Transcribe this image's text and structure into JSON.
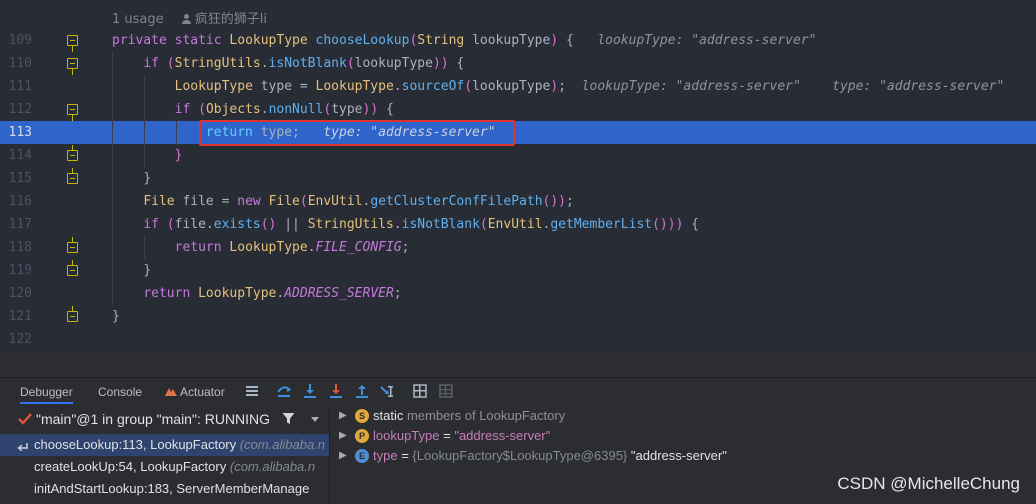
{
  "editor": {
    "usage_count": "1 usage",
    "author": "疯狂的狮子li",
    "lines": [
      {
        "num": "109",
        "tokens": [
          [
            "kw",
            "private "
          ],
          [
            "kw",
            "static "
          ],
          [
            "ty",
            "LookupType "
          ],
          [
            "fn",
            "chooseLookup"
          ],
          [
            "par",
            "("
          ],
          [
            "ty",
            "String "
          ],
          [
            "pun",
            "lookupType"
          ],
          [
            "par",
            ")"
          ],
          [
            "pun",
            " {   "
          ],
          [
            "hint",
            "lookupType: \"address-server\""
          ]
        ]
      },
      {
        "num": "110",
        "tokens": [
          [
            "pun",
            "    "
          ],
          [
            "kw",
            "if "
          ],
          [
            "par",
            "("
          ],
          [
            "ty",
            "StringUtils"
          ],
          [
            "pun",
            "."
          ],
          [
            "fn",
            "isNotBlank"
          ],
          [
            "par",
            "("
          ],
          [
            "pun",
            "lookupType"
          ],
          [
            "par",
            "))"
          ],
          [
            "pun",
            " {"
          ]
        ]
      },
      {
        "num": "111",
        "tokens": [
          [
            "pun",
            "        "
          ],
          [
            "ty",
            "LookupType "
          ],
          [
            "pun",
            "type = "
          ],
          [
            "ty",
            "LookupType"
          ],
          [
            "pun",
            "."
          ],
          [
            "fn",
            "sourceOf"
          ],
          [
            "par",
            "("
          ],
          [
            "pun",
            "lookupType"
          ],
          [
            "par",
            ")"
          ],
          [
            "pun",
            ";  "
          ],
          [
            "hint",
            "lookupType: \"address-server\"    type: \"address-server\""
          ]
        ]
      },
      {
        "num": "112",
        "tokens": [
          [
            "pun",
            "        "
          ],
          [
            "kw",
            "if "
          ],
          [
            "par",
            "("
          ],
          [
            "ty",
            "Objects"
          ],
          [
            "pun",
            "."
          ],
          [
            "fn",
            "nonNull"
          ],
          [
            "par",
            "("
          ],
          [
            "pun",
            "type"
          ],
          [
            "par",
            "))"
          ],
          [
            "pun",
            " {"
          ]
        ]
      },
      {
        "num": "113",
        "tokens": [
          [
            "pun",
            "            "
          ],
          [
            "kw",
            "return "
          ],
          [
            "pun",
            "type;   "
          ],
          [
            "hint",
            "type: \"address-server\""
          ]
        ]
      },
      {
        "num": "114",
        "tokens": [
          [
            "pun",
            "        "
          ],
          [
            "par",
            "}"
          ]
        ]
      },
      {
        "num": "115",
        "tokens": [
          [
            "pun",
            "    "
          ],
          [
            "pun",
            "}"
          ]
        ]
      },
      {
        "num": "116",
        "tokens": [
          [
            "pun",
            "    "
          ],
          [
            "ty",
            "File "
          ],
          [
            "pun",
            "file = "
          ],
          [
            "kw",
            "new "
          ],
          [
            "ty",
            "File"
          ],
          [
            "par",
            "("
          ],
          [
            "ty",
            "EnvUtil"
          ],
          [
            "pun",
            "."
          ],
          [
            "fn",
            "getClusterConfFilePath"
          ],
          [
            "par",
            "())"
          ],
          [
            "pun",
            ";"
          ]
        ]
      },
      {
        "num": "117",
        "tokens": [
          [
            "pun",
            "    "
          ],
          [
            "kw",
            "if "
          ],
          [
            "par",
            "("
          ],
          [
            "pun",
            "file."
          ],
          [
            "fn",
            "exists"
          ],
          [
            "par",
            "()"
          ],
          [
            "pun",
            " || "
          ],
          [
            "ty",
            "StringUtils"
          ],
          [
            "pun",
            "."
          ],
          [
            "fn",
            "isNotBlank"
          ],
          [
            "par",
            "("
          ],
          [
            "ty",
            "EnvUtil"
          ],
          [
            "pun",
            "."
          ],
          [
            "fn",
            "getMemberList"
          ],
          [
            "par",
            "()))"
          ],
          [
            "pun",
            " {"
          ]
        ]
      },
      {
        "num": "118",
        "tokens": [
          [
            "pun",
            "        "
          ],
          [
            "kw",
            "return "
          ],
          [
            "ty",
            "LookupType"
          ],
          [
            "pun",
            "."
          ],
          [
            "cst",
            "FILE_CONFIG"
          ],
          [
            "pun",
            ";"
          ]
        ]
      },
      {
        "num": "119",
        "tokens": [
          [
            "pun",
            "    "
          ],
          [
            "pun",
            "}"
          ]
        ]
      },
      {
        "num": "120",
        "tokens": [
          [
            "pun",
            "    "
          ],
          [
            "kw",
            "return "
          ],
          [
            "ty",
            "LookupType"
          ],
          [
            "pun",
            "."
          ],
          [
            "cst",
            "ADDRESS_SERVER"
          ],
          [
            "pun",
            ";"
          ]
        ]
      },
      {
        "num": "121",
        "tokens": [
          [
            "pun",
            "}"
          ]
        ]
      },
      {
        "num": "122",
        "tokens": []
      }
    ]
  },
  "debugger": {
    "tabs": [
      "Debugger",
      "Console",
      "Actuator"
    ],
    "thread": "\"main\"@1 in group \"main\": RUNNING",
    "frames": [
      {
        "method": "chooseLookup:113, LookupFactory",
        "pkg": "(com.alibaba.n"
      },
      {
        "method": "createLookUp:54, LookupFactory",
        "pkg": "(com.alibaba.n"
      },
      {
        "method": "initAndStartLookup:183, ServerMemberManage",
        "pkg": ""
      }
    ],
    "variables": [
      {
        "badge": "S",
        "badge_color": "#e0a83a",
        "label": "static members of LookupFactory"
      },
      {
        "badge": "P",
        "badge_color": "#e0a83a",
        "name": "lookupType",
        "value": "\"address-server\""
      },
      {
        "badge": "E",
        "badge_color": "#4f8fd6",
        "name": "type",
        "type": "{LookupFactory$LookupType@6395}",
        "value": "\"address-server\""
      }
    ]
  },
  "watermark": "CSDN @MichelleChung"
}
